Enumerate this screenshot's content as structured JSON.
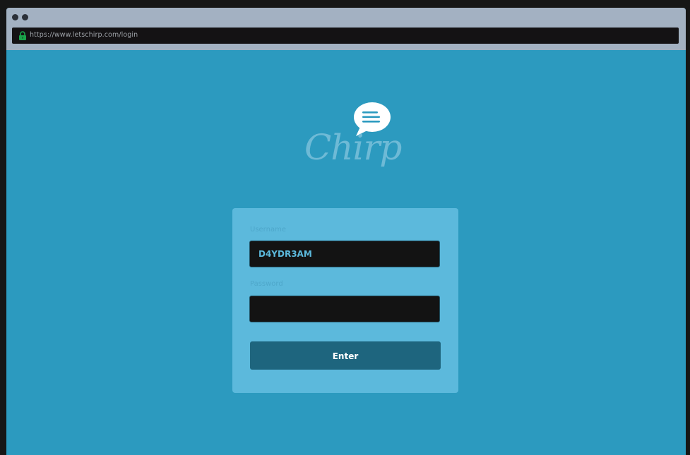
{
  "browser": {
    "url": "https://www.letschirp.com/login"
  },
  "brand": {
    "name": "Chirp",
    "logo_icon": "speech-bubble-icon"
  },
  "login": {
    "username_label": "Username",
    "username_value": "D4YDR3AM",
    "password_label": "Password",
    "password_value": "",
    "enter_label": "Enter"
  },
  "colors": {
    "page_background": "#2c9abf",
    "card_background": "#5cb9dc",
    "button_background": "#1e657e",
    "input_background": "#131313",
    "lock_icon": "#1aa34a"
  }
}
